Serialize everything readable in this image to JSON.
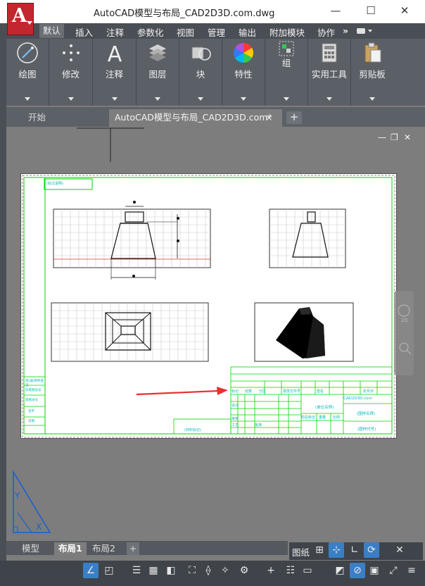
{
  "title": "AutoCAD模型与布局_CAD2D3D.com.dwg",
  "app_button": {
    "letter": "A"
  },
  "window_controls": {
    "minimize": "—",
    "maximize": "☐",
    "close": "✕"
  },
  "menu": {
    "items": [
      "默认",
      "插入",
      "注释",
      "参数化",
      "视图",
      "管理",
      "输出",
      "附加模块",
      "协作"
    ],
    "more": "»"
  },
  "ribbon": {
    "panels": [
      "绘图",
      "修改",
      "注释",
      "图层",
      "块",
      "特性",
      "组",
      "实用工具",
      "剪贴板"
    ]
  },
  "doc_tabs": {
    "start": "开始",
    "active": "AutoCAD模型与布局_CAD2D3D.com*",
    "close": "×",
    "add": "+"
  },
  "viewport_controls": {
    "minimize": "—",
    "restore": "❐",
    "close": "✕"
  },
  "drawing": {
    "tag_top": "(标注说明)",
    "title_block": {
      "company": "CAD2D3D.com",
      "drawing_name": "(图样名称)",
      "drawing_code": "(图样代号)",
      "unit_name": "(单位名称)",
      "label_stage": "阶段标记",
      "label_weight": "重量",
      "label_ratio": "比例",
      "label_design": "设计",
      "label_check": "审核",
      "label_process": "工艺",
      "label_approve": "批准",
      "col_mark": "标记",
      "col_count": "处数",
      "col_zone": "分区",
      "col_doc": "更改文件号",
      "col_sign": "签名",
      "col_date": "年月日"
    },
    "left_labels": [
      "借(通)用件登记",
      "旧底图总号",
      "底图总号",
      "签字",
      "日期"
    ],
    "bottom_label": "(材料标记)"
  },
  "layout_tabs": {
    "model": "模型",
    "layout1": "布局1",
    "layout2": "布局2",
    "add": "+"
  },
  "status": {
    "paper": "图纸"
  },
  "colors": {
    "accent": "#3a7fc6",
    "app_red": "#c1272d",
    "drawing_green": "#00d400",
    "drawing_cyan": "#00c8c8",
    "arrow_red": "#e8312f"
  },
  "icons": [
    "pencil-icon",
    "move-icon",
    "text-icon",
    "layers-icon",
    "block-icon",
    "color-wheel-icon",
    "group-icon",
    "calculator-icon",
    "clipboard-icon"
  ]
}
